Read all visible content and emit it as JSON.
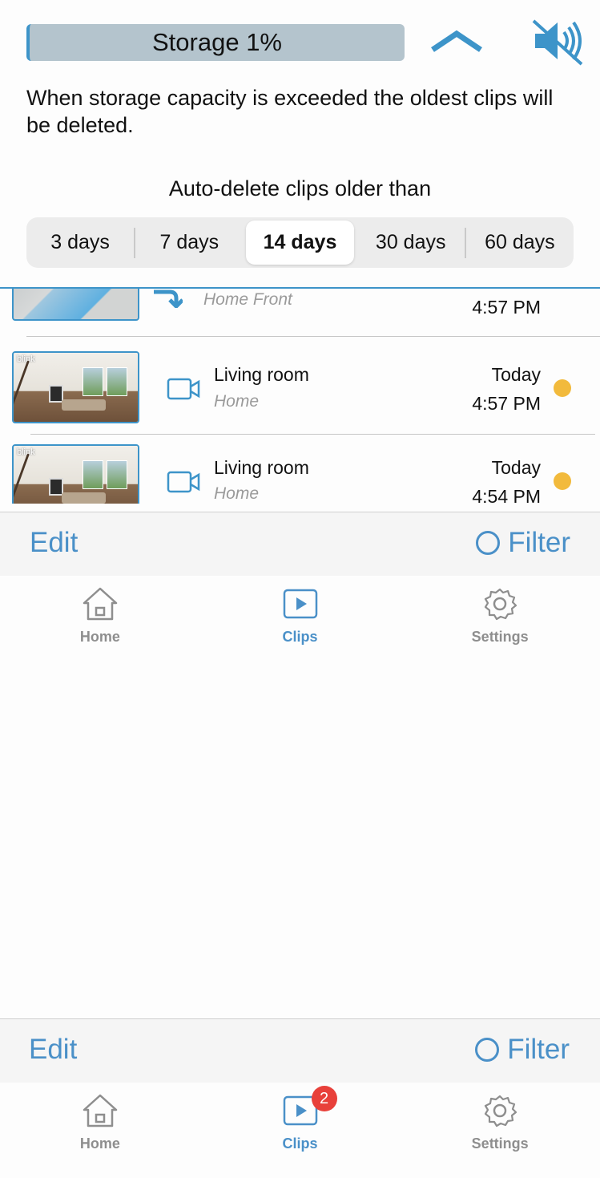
{
  "header": {
    "storage_label": "Storage 1%",
    "info_text": "When storage capacity is exceeded the oldest clips will be deleted.",
    "auto_delete_title": "Auto-delete clips older than",
    "options": [
      "3 days",
      "7 days",
      "14 days",
      "30 days",
      "60 days"
    ],
    "selected_option": "14 days"
  },
  "clips": [
    {
      "name": "",
      "location": "Home Front",
      "day": "",
      "time": "4:57 PM",
      "icon": "motion-arrow-icon",
      "unread": false
    },
    {
      "name": "Living room",
      "location": "Home",
      "day": "Today",
      "time": "4:57 PM",
      "icon": "camera-icon",
      "unread": true
    },
    {
      "name": "Living room",
      "location": "Home",
      "day": "Today",
      "time": "4:54 PM",
      "icon": "camera-icon",
      "unread": true
    }
  ],
  "thumb_brand": "blink",
  "toolbar": {
    "edit_label": "Edit",
    "filter_label": "Filter"
  },
  "tabs": [
    {
      "label": "Home",
      "icon": "home-icon"
    },
    {
      "label": "Clips",
      "icon": "clips-icon"
    },
    {
      "label": "Settings",
      "icon": "gear-icon"
    }
  ],
  "bottom_toolbar": {
    "edit_label": "Edit",
    "filter_label": "Filter"
  },
  "bottom_tabs": [
    {
      "label": "Home",
      "icon": "home-icon"
    },
    {
      "label": "Clips",
      "icon": "clips-icon",
      "badge": "2"
    },
    {
      "label": "Settings",
      "icon": "gear-icon"
    }
  ],
  "colors": {
    "accent": "#4a90c8",
    "unread_dot": "#f2ba3c",
    "badge": "#e8403a",
    "storage_bar": "#b4c4cd"
  }
}
